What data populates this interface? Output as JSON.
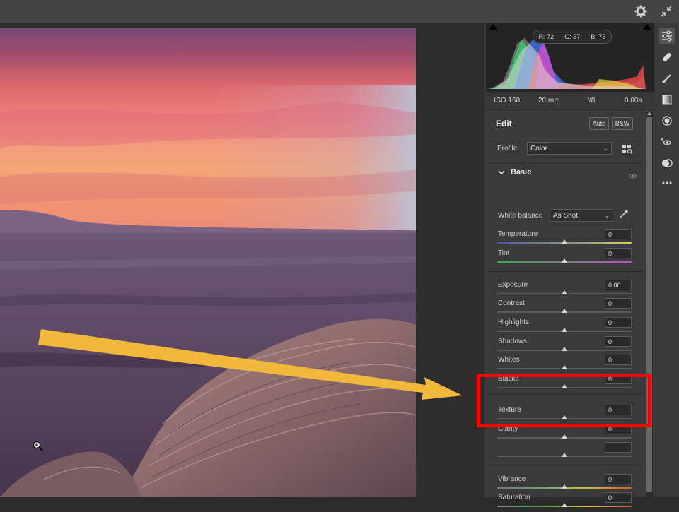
{
  "colors": {
    "highlight": "#ff0000",
    "arrow": "#f2b83c",
    "panel_bg": "#3a3a3a",
    "accent": "#e8e8e8"
  },
  "topbar": {
    "icons": [
      "gear-icon",
      "collapse-icon"
    ]
  },
  "histogram": {
    "r": "R: 72",
    "g": "G: 57",
    "b": "B: 75"
  },
  "exif": {
    "iso": "ISO 160",
    "focal": "20 mm",
    "aperture": "f/8",
    "shutter": "0.80s"
  },
  "edit": {
    "title": "Edit",
    "auto": "Auto",
    "bw": "B&W"
  },
  "profile": {
    "label": "Profile",
    "value": "Color"
  },
  "basic": {
    "title": "Basic"
  },
  "white_balance": {
    "label": "White balance",
    "value": "As Shot"
  },
  "sliders": [
    {
      "label": "Temperature",
      "value": "0",
      "level": 0.5
    },
    {
      "label": "Tint",
      "value": "0",
      "level": 0.5
    },
    {
      "label": "Exposure",
      "value": "0.00",
      "level": 0.5
    },
    {
      "label": "Contrast",
      "value": "0",
      "level": 0.5
    },
    {
      "label": "Highlights",
      "value": "0",
      "level": 0.5
    },
    {
      "label": "Shadows",
      "value": "0",
      "level": 0.5
    },
    {
      "label": "Whites",
      "value": "0",
      "level": 0.5
    },
    {
      "label": "Blacks",
      "value": "0",
      "level": 0.5
    },
    {
      "label": "Texture",
      "value": "0",
      "level": 0.5
    },
    {
      "label": "Clarity",
      "value": "0",
      "level": 0.5
    },
    {
      "label": "",
      "value": "",
      "level": 0.5
    },
    {
      "label": "Vibrance",
      "value": "0",
      "level": 0.5
    },
    {
      "label": "Saturation",
      "value": "0",
      "level": 0.5
    }
  ],
  "tools": [
    "edit-sliders-icon",
    "healing-icon",
    "brush-icon",
    "gradient-icon",
    "radial-icon",
    "redeye-icon",
    "presets-icon",
    "more-icon"
  ]
}
